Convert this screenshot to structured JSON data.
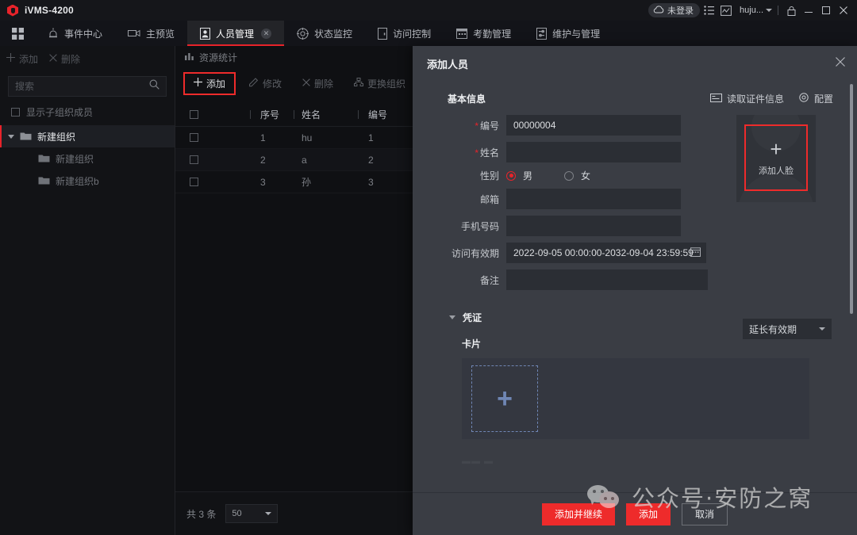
{
  "titlebar": {
    "app_title": "iVMS-4200",
    "login_status": "未登录",
    "user": "huju...",
    "icons": [
      "cloud-icon",
      "list-icon",
      "chart-icon",
      "lock-icon",
      "minimize-icon",
      "maximize-icon",
      "close-icon"
    ]
  },
  "tabbar": {
    "tabs": [
      {
        "label": "事件中心",
        "icon": "alarm-icon",
        "active": false
      },
      {
        "label": "主预览",
        "icon": "camera-icon",
        "active": false
      },
      {
        "label": "人员管理",
        "icon": "person-card-icon",
        "active": true,
        "closable": true
      },
      {
        "label": "状态监控",
        "icon": "target-icon",
        "active": false
      },
      {
        "label": "访问控制",
        "icon": "door-icon",
        "active": false
      },
      {
        "label": "考勤管理",
        "icon": "calendar-icon",
        "active": false
      },
      {
        "label": "维护与管理",
        "icon": "settings-list-icon",
        "active": false
      }
    ]
  },
  "left_panel": {
    "add_label": "添加",
    "delete_label": "删除",
    "search_placeholder": "搜索",
    "show_sub_label": "显示子组织成员",
    "tree": [
      {
        "label": "新建组织",
        "level": 0,
        "selected": true,
        "expanded": true
      },
      {
        "label": "新建组织",
        "level": 1,
        "selected": false
      },
      {
        "label": "新建组织b",
        "level": 1,
        "selected": false
      }
    ]
  },
  "mid_panel": {
    "resource_stat": "资源统计",
    "toolbar": [
      {
        "label": "添加",
        "icon": "plus-icon",
        "highlighted": true
      },
      {
        "label": "修改",
        "icon": "edit-icon",
        "highlighted": false
      },
      {
        "label": "删除",
        "icon": "x-icon",
        "highlighted": false
      },
      {
        "label": "更换组织",
        "icon": "org-icon",
        "highlighted": false
      }
    ],
    "table": {
      "columns": [
        "序号",
        "姓名",
        "编号"
      ],
      "rows": [
        {
          "seq": "1",
          "name": "hu",
          "num": "1"
        },
        {
          "seq": "2",
          "name": "a",
          "num": "2"
        },
        {
          "seq": "3",
          "name": "孙",
          "num": "3"
        }
      ]
    },
    "pager": {
      "total_text": "共 3 条",
      "page_size": "50"
    }
  },
  "modal": {
    "title": "添加人员",
    "section_basic": "基本信息",
    "read_card_label": "读取证件信息",
    "config_label": "配置",
    "fields": {
      "number_label": "编号",
      "number_value": "00000004",
      "name_label": "姓名",
      "name_value": "",
      "gender_label": "性别",
      "gender_male": "男",
      "gender_female": "女",
      "gender_selected": "男",
      "email_label": "邮箱",
      "email_value": "",
      "phone_label": "手机号码",
      "phone_value": "",
      "valid_label": "访问有效期",
      "valid_value": "2022-09-05 00:00:00-2032-09-04 23:59:59",
      "note_label": "备注",
      "note_value": ""
    },
    "photo": {
      "add_face_label": "添加人脸"
    },
    "extend_select": "延长有效期",
    "credentials": {
      "section_label": "凭证",
      "card_label": "卡片"
    },
    "footer": {
      "add_continue_label": "添加并继续",
      "add_label": "添加",
      "cancel_label": "取消"
    }
  },
  "watermark": {
    "text": "公众号·安防之窝"
  },
  "colors": {
    "accent_red": "#e8232a",
    "button_red": "#ee2b2b",
    "modal_bg": "#3a3d44",
    "app_bg": "#0d0e11",
    "dashed_blue": "#6f86b4"
  }
}
